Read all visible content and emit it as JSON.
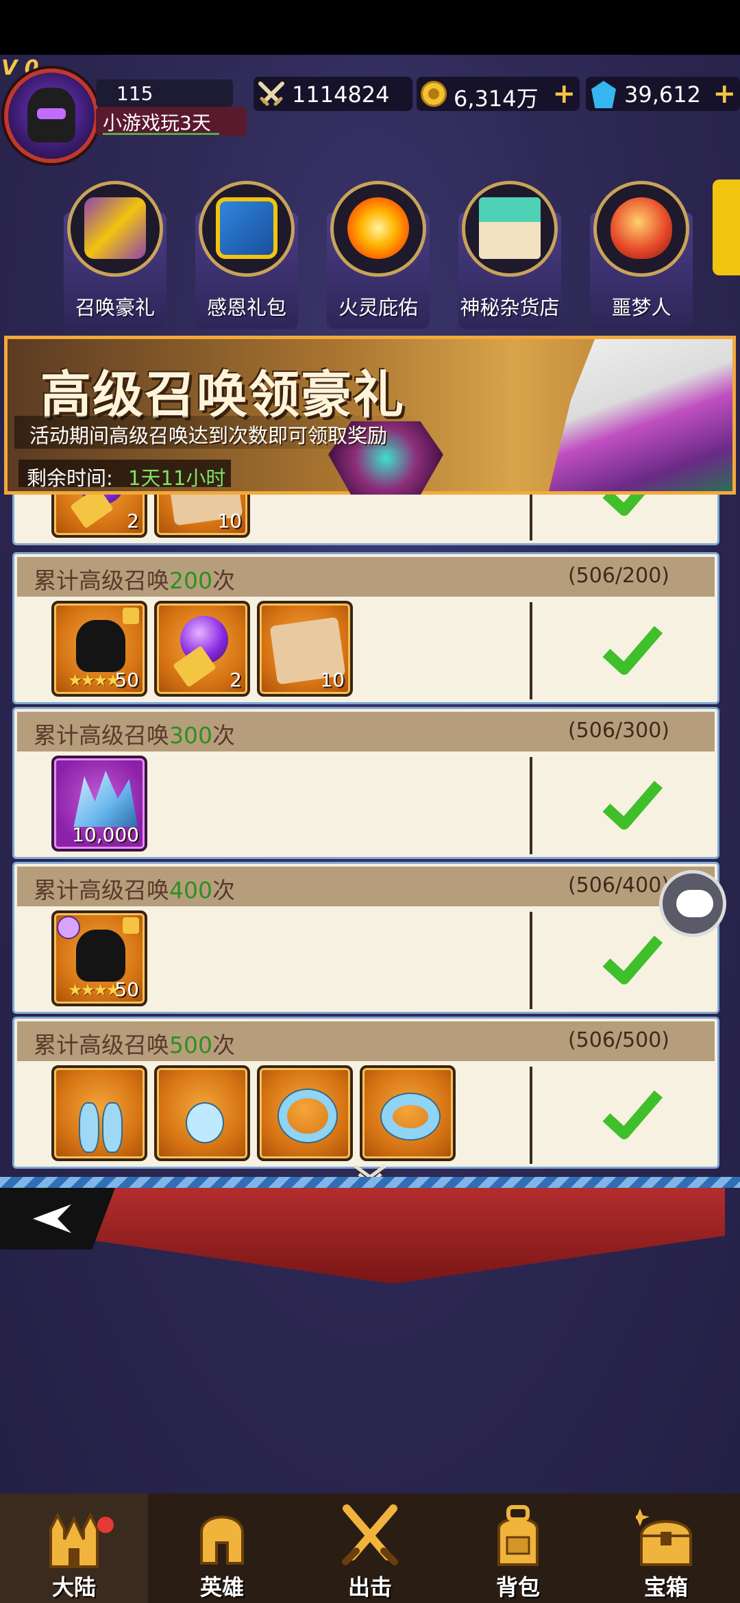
{
  "header": {
    "vip": "V 0",
    "level": "115",
    "player_name": "小游戏玩3天",
    "power": "1114824",
    "gold": "6,314万",
    "gems": "39,612",
    "plus": "+"
  },
  "events": [
    {
      "label": "召唤豪礼",
      "icon": "gift-box-icon"
    },
    {
      "label": "感恩礼包",
      "icon": "gift-package-icon"
    },
    {
      "label": "火灵庇佑",
      "icon": "fire-spirit-icon"
    },
    {
      "label": "神秘杂货店",
      "icon": "shop-icon"
    },
    {
      "label": "噩梦人",
      "icon": "dragon-egg-icon"
    }
  ],
  "banner": {
    "title": "高级召唤领豪礼",
    "subtitle": "活动期间高级召唤达到次数即可领取奖励",
    "timer_label": "剩余时间:",
    "timer_value": "1天11小时"
  },
  "milestones": [
    {
      "prefix": "累计高级召唤",
      "count": "200",
      "suffix": "次",
      "progress": "(506/200)",
      "items": [
        {
          "type": "helmet-shard",
          "qty": "50"
        },
        {
          "type": "orb-wand",
          "qty": "2"
        },
        {
          "type": "scroll",
          "qty": "10"
        }
      ]
    },
    {
      "prefix": "累计高级召唤",
      "count": "300",
      "suffix": "次",
      "progress": "(506/300)",
      "items": [
        {
          "type": "crystal",
          "qty": "10,000"
        }
      ]
    },
    {
      "prefix": "累计高级召唤",
      "count": "400",
      "suffix": "次",
      "progress": "(506/400)",
      "items": [
        {
          "type": "helmet-shard",
          "qty": "50"
        }
      ]
    },
    {
      "prefix": "累计高级召唤",
      "count": "500",
      "suffix": "次",
      "progress": "(506/500)",
      "items": [
        {
          "type": "earrings",
          "qty": ""
        },
        {
          "type": "pendant",
          "qty": ""
        },
        {
          "type": "ring",
          "qty": ""
        },
        {
          "type": "band",
          "qty": ""
        }
      ]
    }
  ],
  "partial_row": {
    "qty_1": "2",
    "qty_2": "10"
  },
  "nav": [
    {
      "label": "大陆",
      "icon": "castle-icon"
    },
    {
      "label": "英雄",
      "icon": "helmet-icon"
    },
    {
      "label": "出击",
      "icon": "crossed-swords-icon"
    },
    {
      "label": "背包",
      "icon": "backpack-icon"
    },
    {
      "label": "宝箱",
      "icon": "treasure-chest-icon"
    }
  ],
  "colors": {
    "accent_gold": "#f5c542",
    "progress_green": "#2f8f20",
    "check_green": "#3fbf2a",
    "timer_green": "#7ee26a"
  }
}
